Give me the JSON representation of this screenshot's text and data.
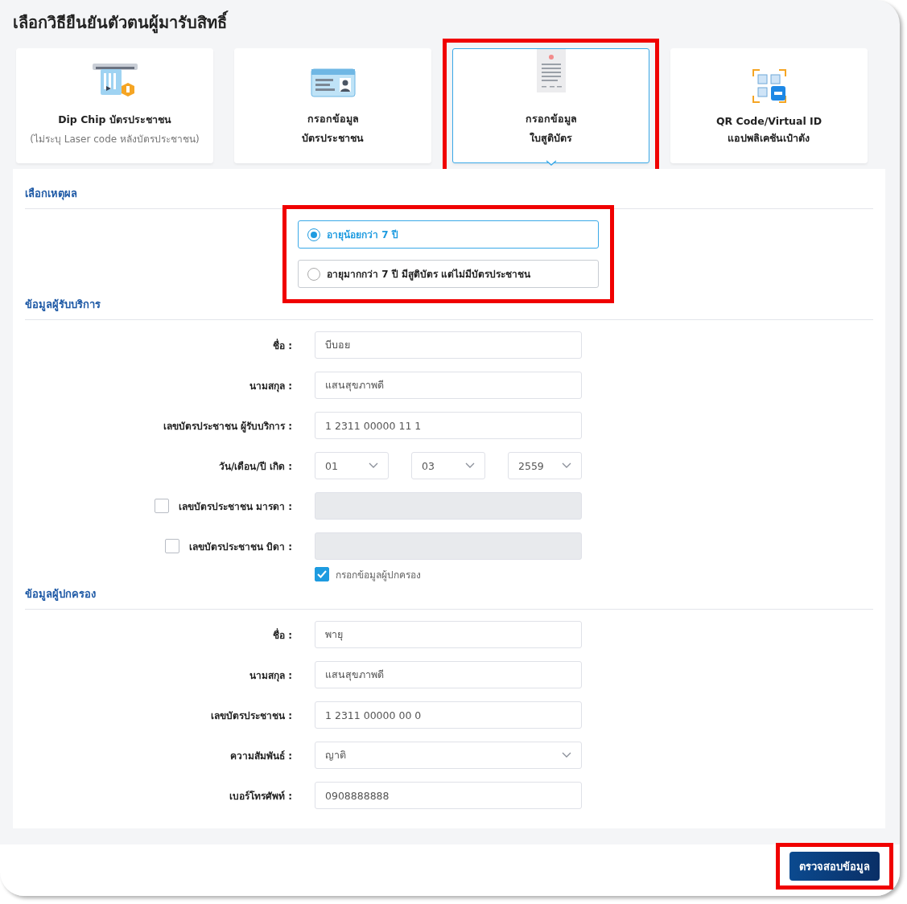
{
  "title": "เลือกวิธียืนยันตัวตนผู้มารับสิทธิ์",
  "methods": [
    {
      "selected": false,
      "highlighted": false,
      "lines": [
        {
          "text": "Dip Chip บัตรประชาชน",
          "kind": "main"
        },
        {
          "text": "(ไม่ระบุ Laser code หลังบัตรประชาชน)",
          "kind": "note"
        }
      ]
    },
    {
      "selected": false,
      "highlighted": false,
      "lines": [
        {
          "text": "กรอกข้อมูล",
          "kind": "main"
        },
        {
          "text": "บัตรประชาชน",
          "kind": "main"
        }
      ]
    },
    {
      "selected": true,
      "highlighted": true,
      "lines": [
        {
          "text": "กรอกข้อมูล",
          "kind": "main"
        },
        {
          "text": "ใบสูติบัตร",
          "kind": "main"
        }
      ]
    },
    {
      "selected": false,
      "highlighted": false,
      "lines": [
        {
          "text": "QR Code/Virtual ID",
          "kind": "main"
        },
        {
          "text": "แอปพลิเคชันเป๋าตัง",
          "kind": "main"
        }
      ]
    }
  ],
  "reason": {
    "heading": "เลือกเหตุผล",
    "highlighted": true,
    "options": [
      {
        "label": "อายุน้อยกว่า 7 ปี",
        "selected": true
      },
      {
        "label": "อายุมากกว่า 7 ปี มีสูติบัตร แต่ไม่มีบัตรประชาชน",
        "selected": false
      }
    ]
  },
  "recipient": {
    "heading": "ข้อมูลผู้รับบริการ",
    "fields": [
      {
        "kind": "text",
        "label": "ชื่อ :",
        "value": "บีบอย"
      },
      {
        "kind": "text",
        "label": "นามสกุล :",
        "value": "แสนสุขภาพดี"
      },
      {
        "kind": "text",
        "label": "เลขบัตรประชาชน ผู้รับบริการ :",
        "value": "1 2311 00000 11 1"
      },
      {
        "kind": "date",
        "label": "วัน/เดือน/ปี เกิด :",
        "parts": [
          "01",
          "03",
          "2559"
        ]
      },
      {
        "kind": "optional",
        "label": "เลขบัตรประชาชน มารดา :",
        "checked": false
      },
      {
        "kind": "optional",
        "label": "เลขบัตรประชาชน บิดา :",
        "checked": false
      }
    ],
    "guardian_toggle": {
      "label": "กรอกข้อมูลผู้ปกครอง",
      "checked": true
    }
  },
  "guardian": {
    "heading": "ข้อมูลผู้ปกครอง",
    "fields": [
      {
        "kind": "text",
        "label": "ชื่อ :",
        "value": "พายุ"
      },
      {
        "kind": "text",
        "label": "นามสกุล :",
        "value": "แสนสุขภาพดี"
      },
      {
        "kind": "text",
        "label": "เลขบัตรประชาชน :",
        "value": "1 2311 00000 00 0"
      },
      {
        "kind": "select",
        "label": "ความสัมพันธ์ :",
        "value": "ญาติ"
      },
      {
        "kind": "text",
        "label": "เบอร์โทรศัพท์ :",
        "value": "0908888888"
      }
    ]
  },
  "submit": {
    "label": "ตรวจสอบข้อมูล",
    "highlighted": true
  }
}
